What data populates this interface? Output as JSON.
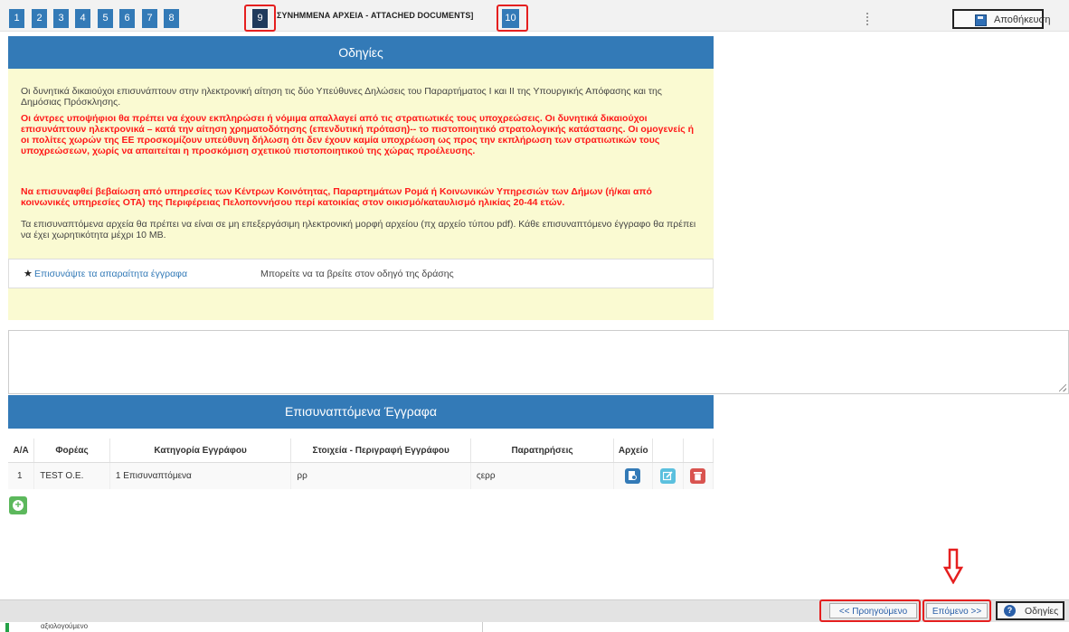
{
  "tabs": [
    "1",
    "2",
    "3",
    "4",
    "5",
    "6",
    "7",
    "8",
    "9",
    "10"
  ],
  "active_tab": "9",
  "tab_title": "ΣΥΝΗΜΜΕΝΑ ΑΡΧΕΙΑ - ATTACHED DOCUMENTS]",
  "save_label": "Αποθήκευση",
  "instructions": {
    "title": "Οδηγίες",
    "p1": "Οι δυνητικά δικαιούχοι επισυνάπτουν στην ηλεκτρονική αίτηση τις δύο Υπεύθυνες Δηλώσεις του Παραρτήματος Ι και ΙΙ της Υπουργικής Απόφασης και της Δημόσιας Πρόσκλησης.",
    "p2": "Οι άντρες υποψήφιοι θα πρέπει να έχουν εκπληρώσει ή νόμιμα απαλλαγεί από τις στρατιωτικές τους υποχρεώσεις. Οι δυνητικά δικαιούχοι επισυνάπτουν ηλεκτρονικά – κατά την αίτηση χρηματοδότησης (επενδυτική πρόταση)-- το πιστοποιητικό στρατολογικής κατάστασης. Οι ομογενείς ή οι πολίτες χωρών της ΕΕ προσκομίζουν υπεύθυνη δήλωση ότι δεν έχουν καμία υποχρέωση ως προς την εκπλήρωση των στρατιωτικών τους υποχρεώσεων, χωρίς να απαιτείται η προσκόμιση σχετικού πιστοποιητικού της χώρας προέλευσης.",
    "p3": "Να επισυναφθεί βεβαίωση από υπηρεσίες των Κέντρων Κοινότητας, Παραρτημάτων Ρομά ή Κοινωνικών Υπηρεσιών των Δήμων (ή/και από κοινωνικές υπηρεσίες ΟΤΑ) της Περιφέρειας Πελοποννήσου περί κατοικίας στον οικισμό/καταυλισμό ηλικίας 20-44 ετών.",
    "p4": "Τα επισυναπτόμενα αρχεία θα πρέπει να είναι σε μη επεξεργάσιμη ηλεκτρονική μορφή αρχείου (πχ αρχείο τύπου pdf). Κάθε επισυναπτόμενο έγγραφο θα πρέπει να έχει χωρητικότητα μέχρι 10 MB.",
    "attach_link": "Επισυνάψτε τα απαραίτητα έγγραφα",
    "attach_hint": "Μπορείτε να τα βρείτε στον οδηγό της δράσης"
  },
  "docs": {
    "title": "Επισυναπτόμενα Έγγραφα",
    "headers": [
      "Α/Α",
      "Φορέας",
      "Κατηγορία Εγγράφου",
      "Στοιχεία - Περιγραφή Εγγράφου",
      "Παρατηρήσεις",
      "Αρχείο"
    ],
    "rows": [
      {
        "no": "1",
        "body": "TEST O.E.",
        "category": "1 Επισυναπτόμενα",
        "description": "ρρ",
        "remarks": "ςερρ"
      }
    ]
  },
  "nav": {
    "prev_label": "<< Προηγούμενο",
    "next_label": "Επόμενο >>",
    "help_label": "Οδηγίες"
  },
  "below_text": "αξιολογούμενο",
  "colors": {
    "header_blue": "#337ab7",
    "instr_bg": "#fafad2",
    "highlight_red": "#e51f1f",
    "warning_red": "#ff1a1a"
  }
}
